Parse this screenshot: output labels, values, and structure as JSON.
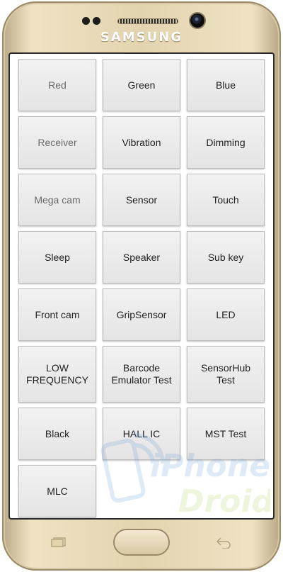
{
  "device": {
    "brand": "SAMSUNG"
  },
  "colors": {
    "body_gold": "#e3d4b0",
    "button_bg": "#e8e8e8",
    "button_border": "#bdbdbd",
    "button_text": "#222222",
    "watermark": "#6ea1d6"
  },
  "watermark": {
    "line1": "iPhone",
    "line2": "Droid"
  },
  "tests": [
    {
      "label": "Red"
    },
    {
      "label": "Green"
    },
    {
      "label": "Blue"
    },
    {
      "label": "Receiver"
    },
    {
      "label": "Vibration"
    },
    {
      "label": "Dimming"
    },
    {
      "label": "Mega cam"
    },
    {
      "label": "Sensor"
    },
    {
      "label": "Touch"
    },
    {
      "label": "Sleep"
    },
    {
      "label": "Speaker"
    },
    {
      "label": "Sub key"
    },
    {
      "label": "Front cam"
    },
    {
      "label": "GripSensor"
    },
    {
      "label": "LED"
    },
    {
      "label": "LOW\nFREQUENCY"
    },
    {
      "label": "Barcode\nEmulator Test"
    },
    {
      "label": "SensorHub\nTest"
    },
    {
      "label": "Black"
    },
    {
      "label": "HALL IC"
    },
    {
      "label": "MST Test"
    },
    {
      "label": "MLC"
    }
  ]
}
